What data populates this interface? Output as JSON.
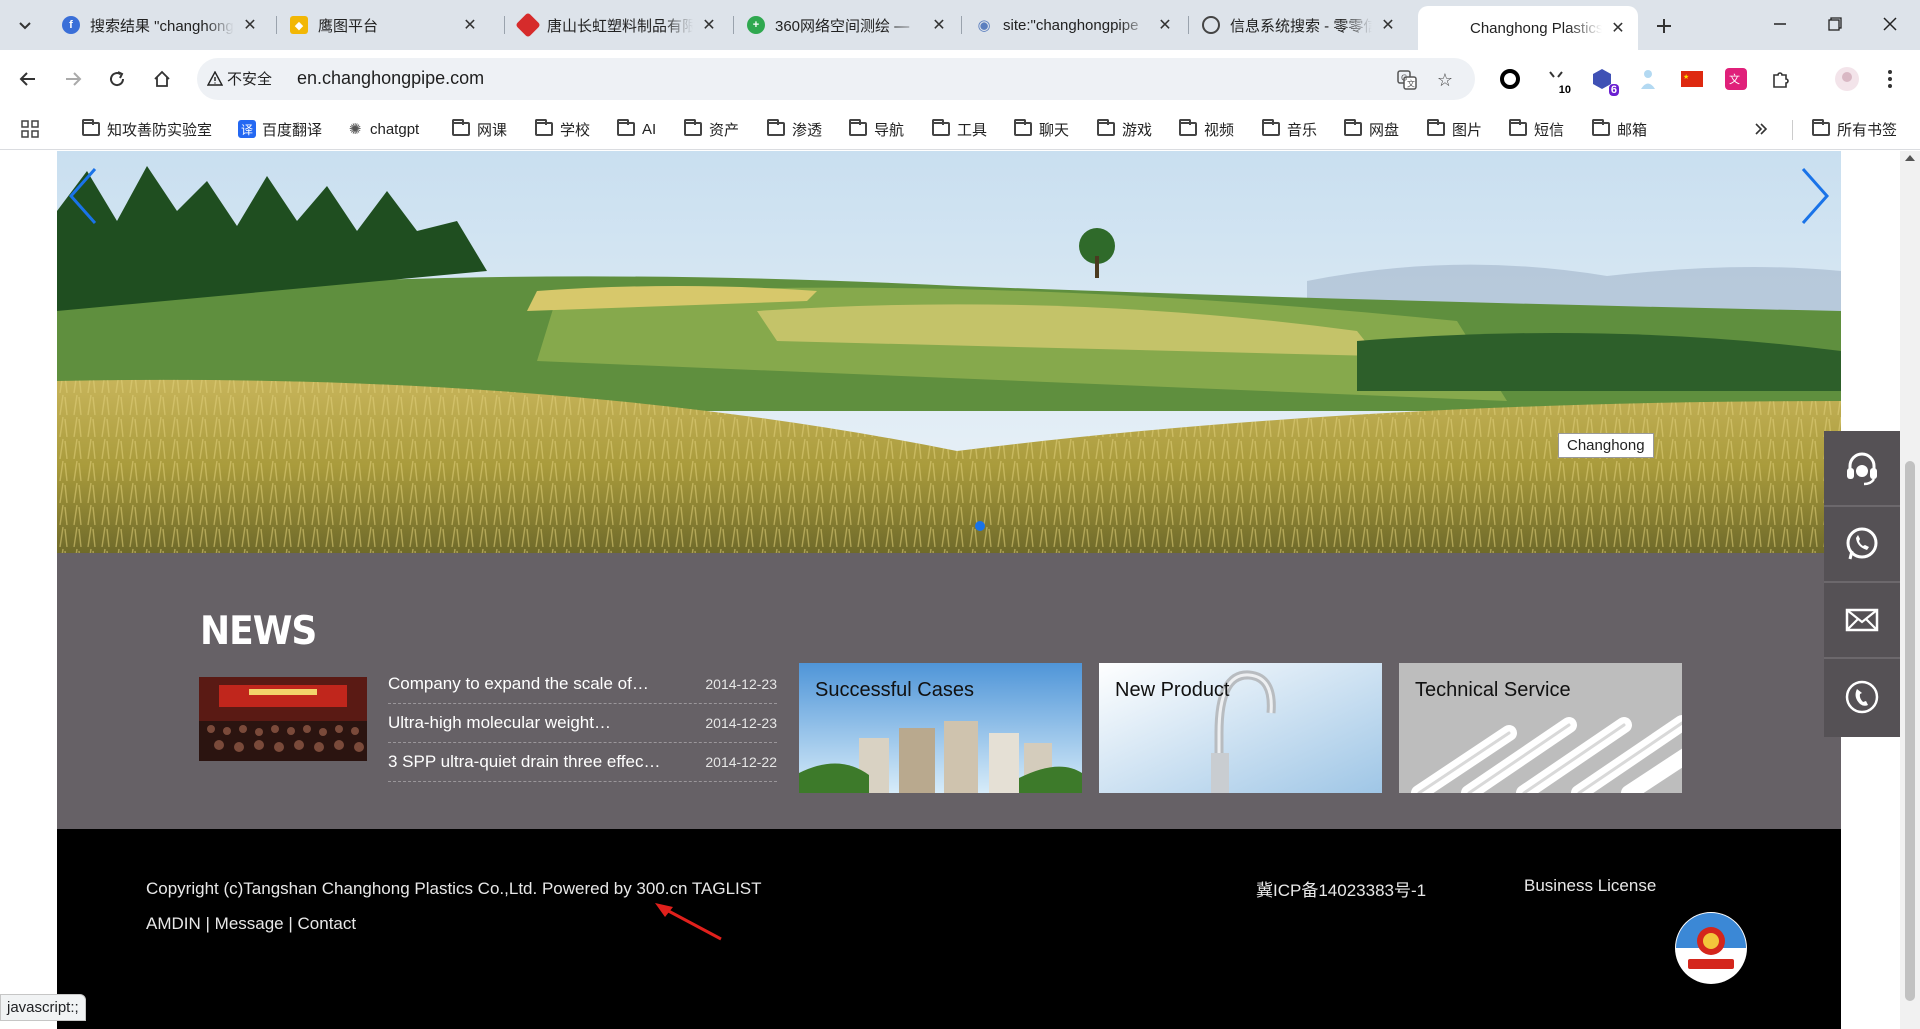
{
  "browser": {
    "tabs": [
      {
        "title": "搜索结果 \"changhong",
        "favicon": "search-favicon",
        "color": "#3a6fd8"
      },
      {
        "title": "鹰图平台",
        "favicon": "eagle-favicon",
        "color": "#f2b705"
      },
      {
        "title": "唐山长虹塑料制品有限公司",
        "favicon": "changhong-favicon",
        "color": "#d62b2b"
      },
      {
        "title": "360网络空间测绘 — ",
        "favicon": "360-favicon",
        "color": "#2fa84f"
      },
      {
        "title": "site:\"changhongpipe",
        "favicon": "eye-favicon",
        "color": "#5b7fbf"
      },
      {
        "title": "信息系统搜索 - 零零信安",
        "favicon": "circle-favicon",
        "color": "#444444"
      },
      {
        "title": "Changhong Plastics",
        "favicon": "none",
        "color": "#ffffff"
      }
    ],
    "active_tab": 6,
    "address": {
      "security_label": "不安全",
      "url": "en.changhongpipe.com"
    },
    "extensions": [
      {
        "icon": "ring-extension-icon",
        "badge": ""
      },
      {
        "icon": "timer-extension-icon",
        "badge": "10"
      },
      {
        "icon": "hexagon-extension-icon",
        "badge": "6"
      },
      {
        "icon": "person-extension-icon",
        "badge": ""
      },
      {
        "icon": "china-flag-extension-icon",
        "badge": ""
      },
      {
        "icon": "translate-extension-icon",
        "badge": ""
      },
      {
        "icon": "puzzle-extension-icon",
        "badge": ""
      }
    ],
    "bookmarks": [
      {
        "label": "知攻善防实验室",
        "type": "folder"
      },
      {
        "label": "百度翻译",
        "type": "site",
        "glyph": "译",
        "color": "#2468f2"
      },
      {
        "label": "chatgpt",
        "type": "site",
        "glyph": "✺",
        "color": "#555555"
      },
      {
        "label": "网课",
        "type": "folder"
      },
      {
        "label": "学校",
        "type": "folder"
      },
      {
        "label": "AI",
        "type": "folder"
      },
      {
        "label": "资产",
        "type": "folder"
      },
      {
        "label": "渗透",
        "type": "folder"
      },
      {
        "label": "导航",
        "type": "folder"
      },
      {
        "label": "工具",
        "type": "folder"
      },
      {
        "label": "聊天",
        "type": "folder"
      },
      {
        "label": "游戏",
        "type": "folder"
      },
      {
        "label": "视频",
        "type": "folder"
      },
      {
        "label": "音乐",
        "type": "folder"
      },
      {
        "label": "网盘",
        "type": "folder"
      },
      {
        "label": "图片",
        "type": "folder"
      },
      {
        "label": "短信",
        "type": "folder"
      },
      {
        "label": "邮箱",
        "type": "folder"
      }
    ],
    "all_bookmarks_label": "所有书签",
    "status_tip": "javascript:;"
  },
  "site": {
    "banner_tag": "Changhong",
    "news_heading": "NEWS",
    "news": [
      {
        "title": "Company to expand the scale of…",
        "date": "2014-12-23"
      },
      {
        "title": "Ultra-high molecular weight…",
        "date": "2014-12-23"
      },
      {
        "title": "3 SPP ultra-quiet drain three effec…",
        "date": "2014-12-22"
      }
    ],
    "tiles": [
      {
        "label": "Successful Cases"
      },
      {
        "label": "New Product"
      },
      {
        "label": "Technical Service"
      }
    ],
    "footer": {
      "copyright": "Copyright (c)Tangshan Changhong Plastics Co.,Ltd. Powered by 300.cn  TAGLIST",
      "links": [
        "AMDIN",
        "Message",
        "Contact"
      ],
      "icp": "冀ICP备14023383号-1",
      "license": "Business License"
    },
    "side_buttons": [
      "headset-icon",
      "whatsapp-icon",
      "mail-icon",
      "phone-icon"
    ]
  },
  "colors": {
    "news_band": "#666166",
    "footer": "#000000",
    "accent_blue": "#1a73e8",
    "arrow_red": "#e0201c"
  }
}
